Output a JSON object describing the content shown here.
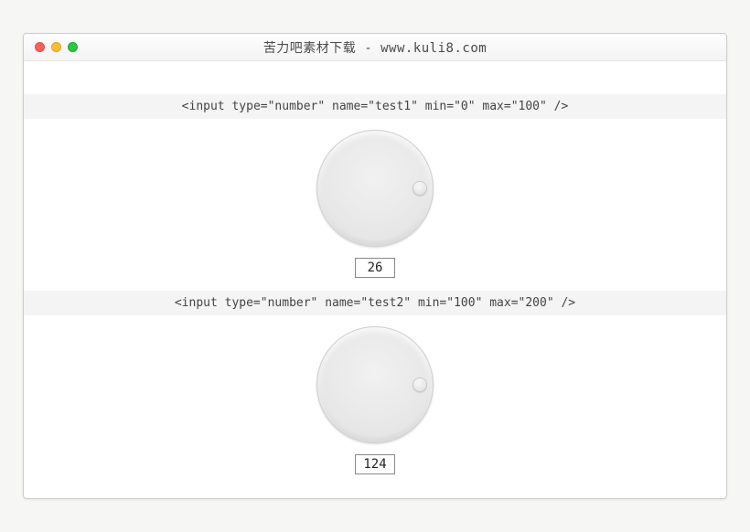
{
  "window": {
    "title": "苦力吧素材下载 - www.kuli8.com"
  },
  "sections": [
    {
      "code": "<input type=\"number\" name=\"test1\" min=\"0\" max=\"100\" />",
      "value": "26"
    },
    {
      "code": "<input type=\"number\" name=\"test2\" min=\"100\" max=\"200\" />",
      "value": "124"
    }
  ]
}
